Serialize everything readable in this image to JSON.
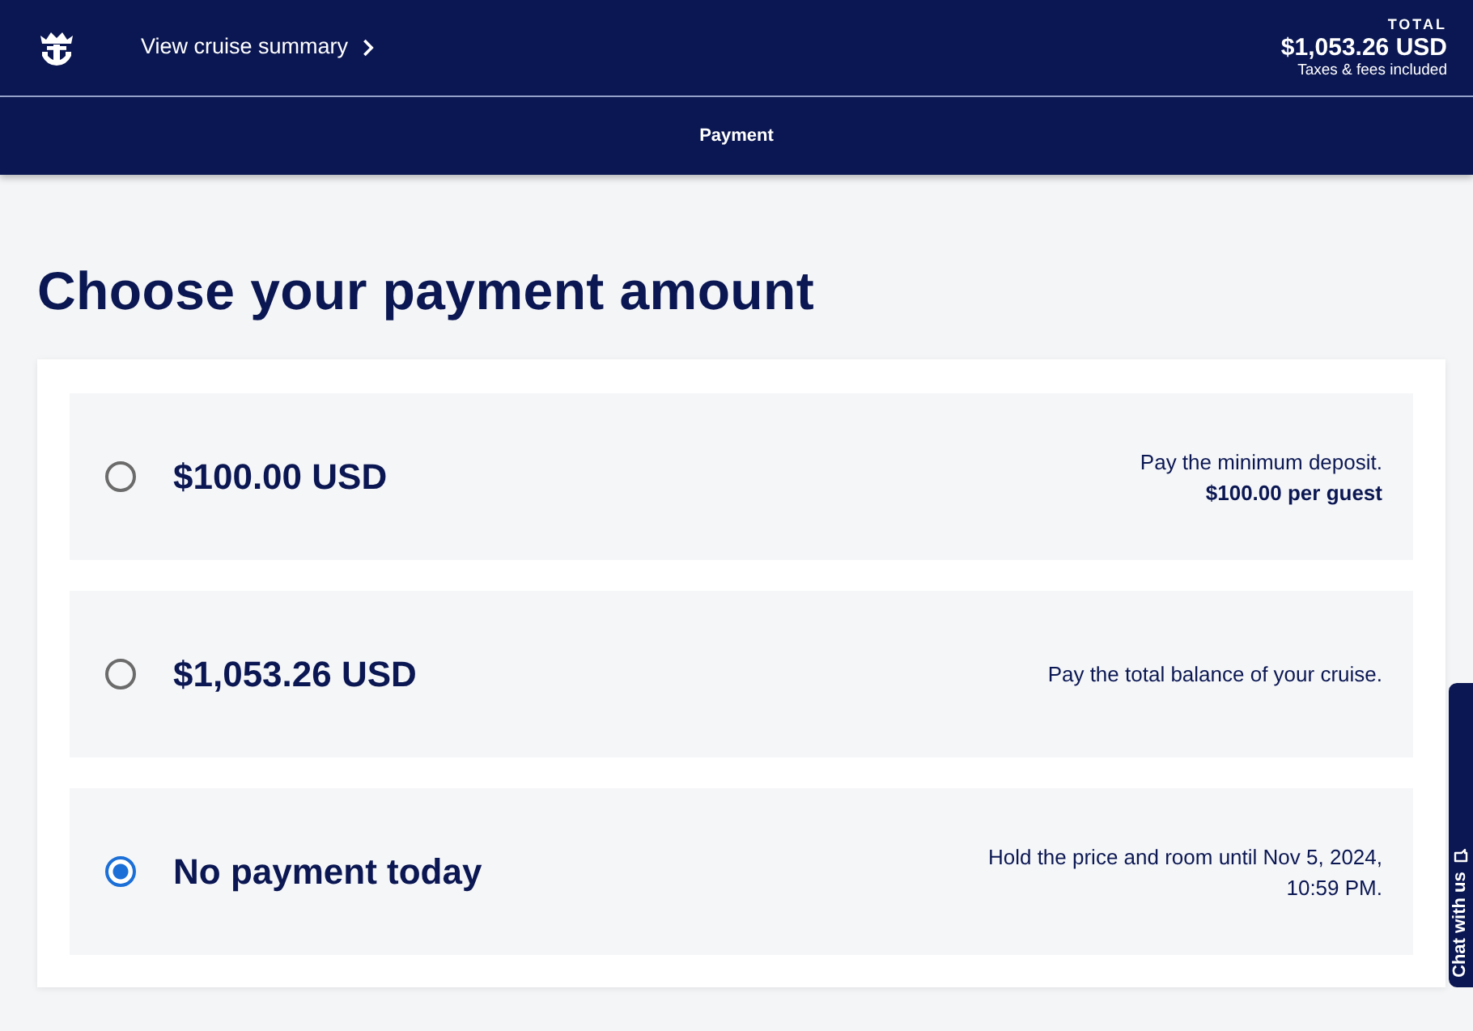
{
  "header": {
    "summary_link": "View cruise summary",
    "total_label": "TOTAL",
    "total_amount": "$1,053.26 USD",
    "total_note": "Taxes & fees included"
  },
  "step_bar": {
    "label": "Payment"
  },
  "title": "Choose your payment amount",
  "options": [
    {
      "amount": "$100.00 USD",
      "description": "Pay the minimum deposit.",
      "note": "$100.00 per guest",
      "selected": false
    },
    {
      "amount": "$1,053.26 USD",
      "description": "Pay the total balance of your cruise.",
      "selected": false
    },
    {
      "amount": "No payment today",
      "description": "Hold the price and room until Nov 5, 2024, 10:59 PM.",
      "selected": true
    }
  ],
  "chat_tab": {
    "label": "Chat with us"
  }
}
